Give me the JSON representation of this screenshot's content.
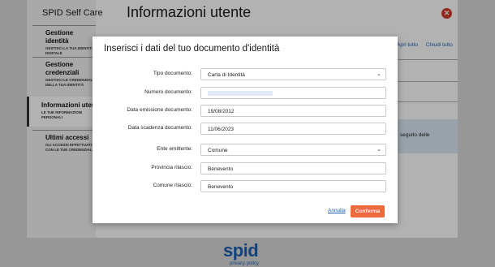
{
  "background": {
    "sidebar_title": "SPID Self Care",
    "page_title": "Informazioni utente",
    "sidebar_items": [
      {
        "title": "Gestione identità",
        "subtitle": "Gestisci la tua identità digitale"
      },
      {
        "title": "Gestione credenziali",
        "subtitle": "Gestisci le credenziali della tua identità"
      },
      {
        "title": "Informazioni utente",
        "subtitle": "Le tue informazioni personali"
      },
      {
        "title": "Ultimi accessi",
        "subtitle": "Gli accessi effettuati con le tue credenziali"
      }
    ],
    "links": {
      "open_all": "Apri tutto",
      "close_all": "Chiudi tutto"
    },
    "info_box_text": "seguito delle",
    "footer_logo": "spid",
    "footer_link": "privacy policy"
  },
  "modal": {
    "title": "Inserisci i dati del tuo documento d'identità",
    "fields": {
      "tipo_documento": {
        "label": "Tipo documento:",
        "value": "Carta di Identità"
      },
      "numero_documento": {
        "label": "Numero documento:",
        "value": ""
      },
      "data_emissione": {
        "label": "Data emissione documento:",
        "value": "19/08/2012"
      },
      "data_scadenza": {
        "label": "Data scadenza documento:",
        "value": "11/06/2023"
      },
      "ente_emittente": {
        "label": "Ente emittente:",
        "value": "Comune"
      },
      "provincia_rilascio": {
        "label": "Provincia rilascio:",
        "value": "Benevento"
      },
      "comune_rilascio": {
        "label": "Comune rilascio:",
        "value": "Benevento"
      }
    },
    "cancel_label": "Annulla",
    "confirm_label": "Conferma"
  },
  "colors": {
    "accent": "#ec6a3b",
    "link": "#1a5fb4",
    "close": "#d63a2a"
  }
}
